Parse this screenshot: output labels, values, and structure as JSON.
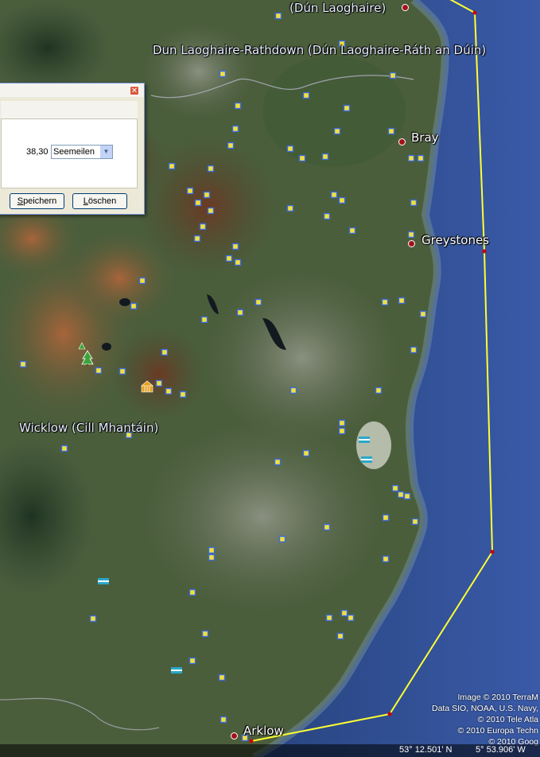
{
  "places": {
    "dun_laoghaire": "(Dún Laoghaire)",
    "region": "Dun Laoghaire-Rathdown (Dún Laoghaire-Ráth an Dúin)",
    "bray": "Bray",
    "greystones": "Greystones",
    "wicklow": "Wicklow (Cill Mhantáin)",
    "arklow": "Arklow"
  },
  "credits": [
    "Image © 2010 TerraM",
    "Data SIO, NOAA, U.S. Navy,",
    "© 2010 Tele Atla",
    "© 2010 Europa Techn",
    "© 2010 Goog"
  ],
  "status": {
    "lat": "53° 12.501' N",
    "lon": "5° 53.906' W"
  },
  "dialog": {
    "distance_value": "38,30",
    "unit_selected": "Seemeilen",
    "save_label": "Speichern",
    "save_accel": "S",
    "delete_label": "Löschen",
    "delete_accel": "L",
    "close_glyph": "✕"
  },
  "colors": {
    "path_line": "#ffff33",
    "vertex": "#cc0000",
    "town_dot": "#a5101a",
    "sea": "#2f4f9a"
  },
  "icons": [
    "placemark-square-icon",
    "park-tree-icon",
    "monument-icon",
    "hotel-bed-icon"
  ]
}
